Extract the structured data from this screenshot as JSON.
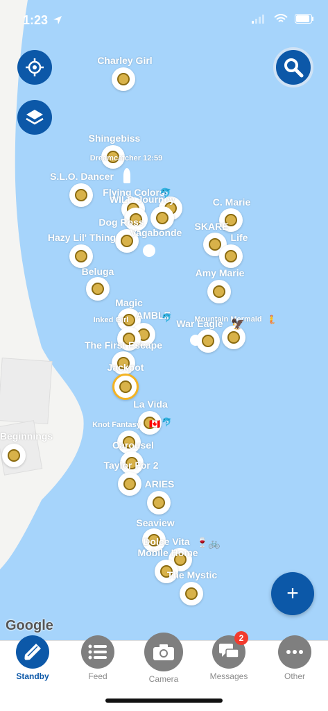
{
  "status_bar": {
    "time": "1:23",
    "location_icon": "location-arrow-icon",
    "signal_icon": "cellular-signal-icon",
    "wifi_icon": "wifi-icon",
    "battery_icon": "battery-icon"
  },
  "map": {
    "google_logo": "Google",
    "locate_icon": "crosshair-icon",
    "layers_icon": "layers-icon",
    "search_icon": "search-icon",
    "add_icon": "plus-icon",
    "vessels": [
      "Charley Girl",
      "Shingebiss",
      "Dreamcatcher 12:59",
      "S.L.O. Dancer",
      "Flying Colors",
      "WILD Journey",
      "Dog Ross",
      "Vagabonde",
      "C. Marie",
      "SKARE",
      "Life",
      "Hazy Lil' Thing",
      "Beluga",
      "Amy Marie",
      "Magic",
      "Inked Girl",
      "AMBLE",
      "Mountain Mermaid",
      "War Eagle",
      "The First Escape",
      "Jackpot",
      "La Vida",
      "Knot Fantasy",
      "Carousel",
      "Taylor For 2",
      "ARIES",
      "Seaview",
      "Dolce Vita",
      "Mobile Home",
      "The Mystic",
      "Beginnings"
    ]
  },
  "tabs": [
    {
      "label": "Standby",
      "icon": "boat-icon",
      "active": true
    },
    {
      "label": "Feed",
      "icon": "list-icon"
    },
    {
      "label": "Camera",
      "icon": "camera-icon"
    },
    {
      "label": "Messages",
      "icon": "chat-icon",
      "badge": "2"
    },
    {
      "label": "Other",
      "icon": "more-icon"
    }
  ],
  "colors": {
    "water": "#a6d4fb",
    "land": "#f4f4f2",
    "primary": "#0c58a8",
    "badge": "#f23b2e",
    "selected_ring": "#f3b323"
  }
}
